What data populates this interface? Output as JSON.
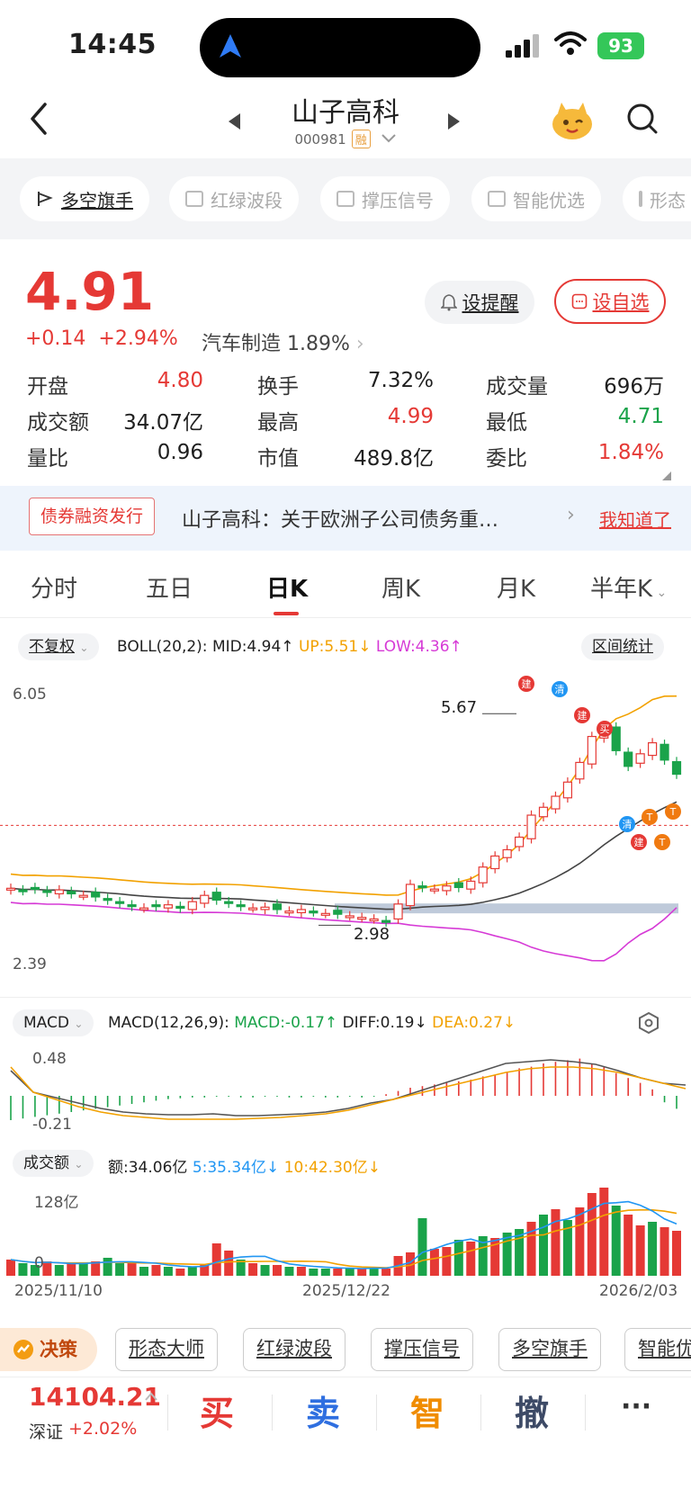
{
  "status": {
    "time": "14:45",
    "battery": "93"
  },
  "header": {
    "title": "山子高科",
    "code": "000981",
    "badge": "融"
  },
  "chips": [
    "多空旗手",
    "红绿波段",
    "撑压信号",
    "智能优选",
    "形态"
  ],
  "quote": {
    "price": "4.91",
    "change": "+0.14",
    "change_pct": "+2.94%",
    "sector": "汽车制造",
    "sector_pct": "1.89%",
    "remind_label": "设提醒",
    "fav_label": "设自选",
    "stats": [
      {
        "label": "开盘",
        "value": "4.80",
        "color": "red"
      },
      {
        "label": "换手",
        "value": "7.32%",
        "color": "black"
      },
      {
        "label": "成交量",
        "value": "696万",
        "color": "black"
      },
      {
        "label": "成交额",
        "value": "34.07亿",
        "color": "black"
      },
      {
        "label": "最高",
        "value": "4.99",
        "color": "red"
      },
      {
        "label": "最低",
        "value": "4.71",
        "color": "green"
      },
      {
        "label": "量比",
        "value": "0.96",
        "color": "black"
      },
      {
        "label": "市值",
        "value": "489.8亿",
        "color": "black"
      },
      {
        "label": "委比",
        "value": "1.84%",
        "color": "red"
      }
    ]
  },
  "notice": {
    "tag": "债券融资发行",
    "text": "山子高科：关于欧洲子公司债务重…",
    "ok": "我知道了"
  },
  "tabs": [
    "分时",
    "五日",
    "日K",
    "周K",
    "月K",
    "半年K"
  ],
  "kline": {
    "adjust": "不复权",
    "boll": {
      "name": "BOLL(20,2):",
      "mid": "MID:4.94↑",
      "up": "UP:5.51↓",
      "low": "LOW:4.36↑"
    },
    "range_stats": "区间统计",
    "y_top": "6.05",
    "y_bottom": "2.39",
    "high_mark": "5.67",
    "low_mark": "2.98",
    "markers": [
      "建",
      "清",
      "建",
      "买",
      "清",
      "建",
      "T",
      "T",
      "T"
    ]
  },
  "macd": {
    "name": "MACD",
    "params": "MACD(12,26,9):",
    "macd": "MACD:-0.17↑",
    "diff": "DIFF:0.19↓",
    "dea": "DEA:0.27↓",
    "y_top": "0.48",
    "y_bottom": "-0.21"
  },
  "volume": {
    "name": "成交额",
    "amount": "额:34.06亿",
    "ma5": "5:35.34亿↓",
    "ma10": "10:42.30亿↓",
    "y_top": "128亿",
    "y_zero": "0"
  },
  "dates": [
    "2025/11/10",
    "2025/12/22",
    "2026/2/03"
  ],
  "bottom_chips": [
    "决策",
    "形态大师",
    "红绿波段",
    "撑压信号",
    "多空旗手",
    "智能优"
  ],
  "index": {
    "value": "14104.21",
    "name": "深证",
    "change": "+2.02%"
  },
  "trade": {
    "buy": "买",
    "sell": "卖",
    "smart": "智",
    "cancel": "撤",
    "more": "···"
  },
  "colors": {
    "up": "#e53935",
    "down": "#1aa34a",
    "accent": "#e53935"
  }
}
